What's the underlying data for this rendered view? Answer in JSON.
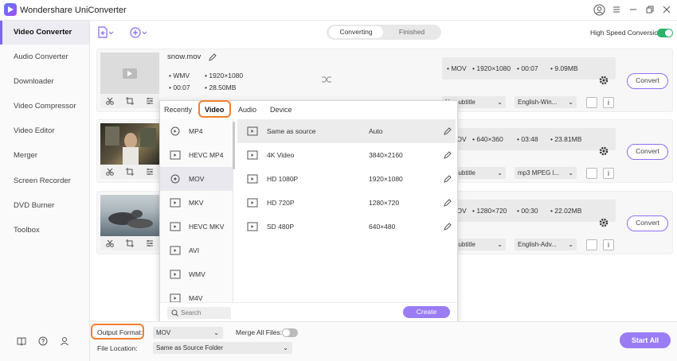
{
  "app": {
    "title": "Wondershare UniConverter"
  },
  "sidebar": {
    "items": [
      {
        "label": "Video Converter"
      },
      {
        "label": "Audio Converter"
      },
      {
        "label": "Downloader"
      },
      {
        "label": "Video Compressor"
      },
      {
        "label": "Video Editor"
      },
      {
        "label": "Merger"
      },
      {
        "label": "Screen Recorder"
      },
      {
        "label": "DVD Burner"
      },
      {
        "label": "Toolbox"
      }
    ]
  },
  "header": {
    "tabs": {
      "converting": "Converting",
      "finished": "Finished"
    },
    "high_speed_label": "High Speed Conversion"
  },
  "files": [
    {
      "name": "snow.mov",
      "format": "WMV",
      "resolution": "1920×1080",
      "duration": "00:07",
      "size": "28.50MB",
      "out_format": "MOV",
      "out_resolution": "1920×1080",
      "out_duration": "00:07",
      "out_size": "9.09MB",
      "subtitle": "No subtitle",
      "audio": "English-Win...",
      "convert": "Convert"
    },
    {
      "out_format": "MOV",
      "out_resolution": "640×360",
      "out_duration": "03:48",
      "out_size": "23.81MB",
      "subtitle": "No subtitle",
      "audio": "mp3 MPEG l...",
      "convert": "Convert"
    },
    {
      "out_format": "MOV",
      "out_resolution": "1280×720",
      "out_duration": "00:30",
      "out_size": "22.02MB",
      "subtitle": "No subtitle",
      "audio": "English-Adv...",
      "convert": "Convert"
    }
  ],
  "popup": {
    "tabs": [
      "Recently",
      "Video",
      "Audio",
      "Device"
    ],
    "formats": [
      "MP4",
      "HEVC MP4",
      "MOV",
      "MKV",
      "HEVC MKV",
      "AVI",
      "WMV",
      "M4V"
    ],
    "qualities": [
      {
        "name": "Same as source",
        "res": "Auto"
      },
      {
        "name": "4K Video",
        "res": "3840×2160"
      },
      {
        "name": "HD 1080P",
        "res": "1920×1080"
      },
      {
        "name": "HD 720P",
        "res": "1280×720"
      },
      {
        "name": "SD 480P",
        "res": "640×480"
      }
    ],
    "search_placeholder": "Search",
    "create": "Create"
  },
  "bottom": {
    "output_label": "Output Format:",
    "output_value": "MOV",
    "merge_label": "Merge All Files:",
    "location_label": "File Location:",
    "location_value": "Same as Source Folder",
    "start_all": "Start All"
  },
  "colors": {
    "accent": "#8e6df5",
    "highlight": "#f08030",
    "toggle_on": "#2db36a"
  }
}
